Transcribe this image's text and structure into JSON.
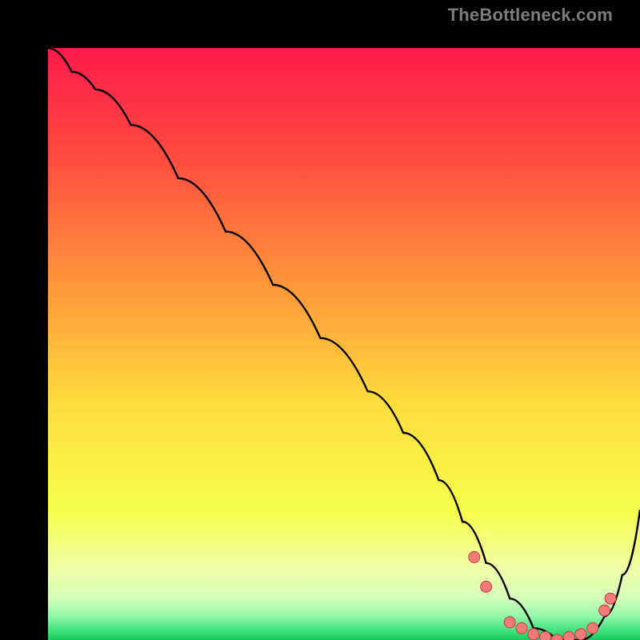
{
  "watermark": "TheBottleneck.com",
  "colors": {
    "page_bg": "#000000",
    "curve": "#000000",
    "dot_fill": "#f47a7a",
    "dot_stroke": "#c93f3f",
    "gradient_stops": [
      {
        "offset": 0.0,
        "color": "#ff1a4b"
      },
      {
        "offset": 0.18,
        "color": "#ff4a3f"
      },
      {
        "offset": 0.4,
        "color": "#ff963a"
      },
      {
        "offset": 0.6,
        "color": "#ffdc3c"
      },
      {
        "offset": 0.78,
        "color": "#f6ff4a"
      },
      {
        "offset": 0.88,
        "color": "#f0ffa8"
      },
      {
        "offset": 0.93,
        "color": "#d3ffb9"
      },
      {
        "offset": 0.96,
        "color": "#92f7a8"
      },
      {
        "offset": 0.985,
        "color": "#3fe27c"
      },
      {
        "offset": 1.0,
        "color": "#17c85d"
      }
    ]
  },
  "chart_data": {
    "type": "line",
    "title": "",
    "xlabel": "",
    "ylabel": "",
    "xlim": [
      0,
      100
    ],
    "ylim": [
      0,
      100
    ],
    "series": [
      {
        "name": "curve",
        "x": [
          0,
          4,
          8,
          14,
          22,
          30,
          38,
          46,
          54,
          60,
          66,
          70,
          74,
          78,
          82,
          86,
          90,
          94,
          97,
          100
        ],
        "y": [
          100,
          96,
          93,
          87,
          78,
          69,
          60,
          51,
          42,
          35,
          27,
          20,
          13,
          7,
          2,
          0,
          0,
          4,
          11,
          22
        ]
      }
    ],
    "markers": {
      "name": "highlight-dots",
      "x": [
        72,
        74,
        78,
        80,
        82,
        84,
        86,
        88,
        90,
        92,
        94,
        95
      ],
      "y": [
        14,
        9,
        3,
        2,
        1,
        0.5,
        0,
        0.5,
        1,
        2,
        5,
        7
      ]
    }
  }
}
